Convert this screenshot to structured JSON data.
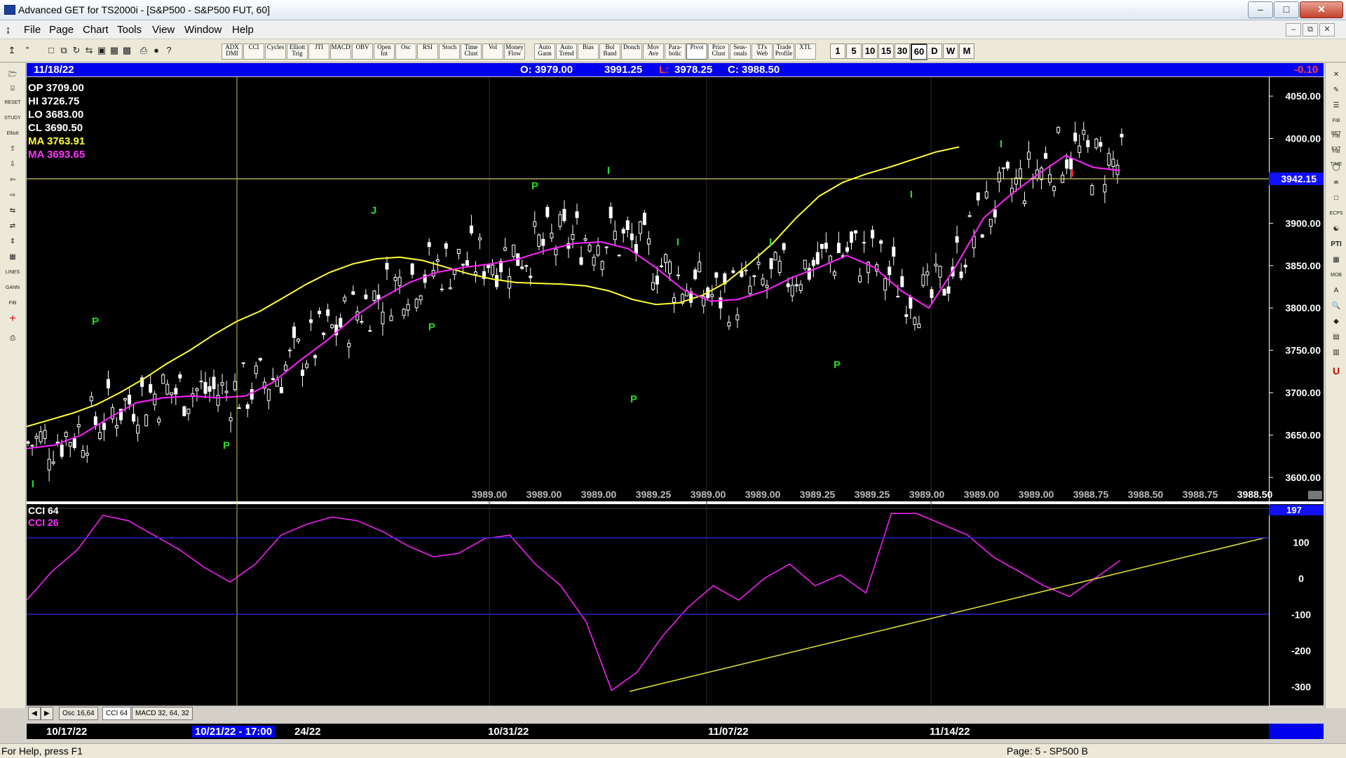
{
  "window": {
    "title": "Advanced GET for TS2000i - [S&P500 - S&P500 FUT, 60]",
    "controls": {
      "minimize": "–",
      "maximize": "□",
      "close": "✕"
    }
  },
  "menu": [
    "File",
    "Page",
    "Chart",
    "Tools",
    "View",
    "Window",
    "Help"
  ],
  "toolbar": {
    "studies": [
      "ADX DMI",
      "CCI",
      "Cycles",
      "Elliott Trig",
      "JTI",
      "MACD",
      "OBV",
      "Open Int",
      "Osc",
      "RSI",
      "Stoch",
      "Time Clust",
      "Vol",
      "Money Flow",
      "Auto Gann",
      "Auto Trend",
      "Bias",
      "Bol Band",
      "Donch",
      "Mov Ave",
      "Para-bolic",
      "Pivot",
      "Price Clust",
      "Seas-onals",
      "TJ's Web",
      "Trade Profile",
      "XTL"
    ],
    "periods": [
      "1",
      "5",
      "10",
      "15",
      "30",
      "60",
      "D",
      "W",
      "M"
    ],
    "selected_period": "60"
  },
  "left_tools": [
    "RESET",
    "STUDY",
    "Elliott",
    "LINES",
    "GANN",
    "FIB"
  ],
  "right_tools": [
    "FIB RET",
    "FIB EXT",
    "FIB TIME",
    "ECPS",
    "PTI",
    "MOB"
  ],
  "infobar": {
    "date": "11/18/22",
    "open": "O: 3979.00",
    "high": "3991.25",
    "low_label": "L:",
    "low": "3978.25",
    "close": "C: 3988.50",
    "change": "-0.10"
  },
  "ohlc": {
    "op": "OP  3709.00",
    "hi": "HI   3726.75",
    "lo": "LO   3683.00",
    "cl": "CL   3690.50",
    "ma1": "MA  3763.91",
    "ma2": "MA  3693.65"
  },
  "price_axis": [
    "4050.00",
    "4000.00",
    "3950.00",
    "3900.00",
    "3850.00",
    "3800.00",
    "3750.00",
    "3700.00",
    "3650.00",
    "3600.00"
  ],
  "crosshair_price": "3942.15",
  "bottom_prices": [
    "3989.00",
    "3989.00",
    "3989.00",
    "3989.25",
    "3989.00",
    "3989.00",
    "3989.25",
    "3989.25",
    "3989.00",
    "3989.00",
    "3989.00",
    "3988.75",
    "3988.50",
    "3988.75",
    "3988.50"
  ],
  "pivot_labels": [
    "P",
    "I",
    "P",
    "J",
    "P",
    "P",
    "I",
    "P",
    "I",
    "I",
    "P",
    "I",
    "I",
    "I"
  ],
  "cci": {
    "label1": "CCI 64",
    "label2": "CCI  26",
    "axis": [
      "100",
      "0",
      "-100",
      "-200",
      "-300"
    ],
    "current": "197"
  },
  "tabs": [
    "Osc 16,64",
    "CCI 64",
    "MACD 32, 64, 32"
  ],
  "selected_tab": "CCI 64",
  "dates": {
    "d1": "10/17/22",
    "cursor": "10/21/22 - 17:00",
    "d2": "24/22",
    "d3": "10/31/22",
    "d4": "11/07/22",
    "d5": "11/14/22"
  },
  "status": {
    "help": "For Help, press F1",
    "page": "Page: 5 - SP500 B"
  },
  "chart_data": {
    "type": "candlestick",
    "price_ylim": [
      3580,
      4060
    ],
    "ma_yellow": [
      3660,
      3668,
      3676,
      3686,
      3700,
      3716,
      3734,
      3750,
      3768,
      3784,
      3796,
      3812,
      3828,
      3842,
      3852,
      3858,
      3860,
      3856,
      3848,
      3840,
      3834,
      3830,
      3829,
      3828,
      3826,
      3820,
      3810,
      3804,
      3806,
      3815,
      3830,
      3852,
      3876,
      3906,
      3932,
      3948,
      3958,
      3966,
      3975,
      3984,
      3990
    ],
    "ma_magenta": [
      3634,
      3638,
      3650,
      3670,
      3688,
      3694,
      3696,
      3694,
      3696,
      3712,
      3738,
      3762,
      3790,
      3812,
      3830,
      3842,
      3848,
      3852,
      3858,
      3868,
      3876,
      3878,
      3870,
      3848,
      3822,
      3808,
      3810,
      3820,
      3836,
      3848,
      3862,
      3848,
      3820,
      3800,
      3850,
      3906,
      3934,
      3958,
      3980,
      3966,
      3962
    ],
    "cci_ylim": [
      -340,
      200
    ],
    "cci": [
      -60,
      20,
      80,
      175,
      160,
      120,
      80,
      30,
      -10,
      40,
      120,
      150,
      170,
      160,
      130,
      90,
      60,
      70,
      110,
      120,
      40,
      -20,
      -120,
      -310,
      -260,
      -160,
      -80,
      -20,
      -60,
      0,
      40,
      -20,
      10,
      -40,
      180,
      180,
      150,
      120,
      60,
      20,
      -20,
      -50,
      0,
      50
    ]
  }
}
